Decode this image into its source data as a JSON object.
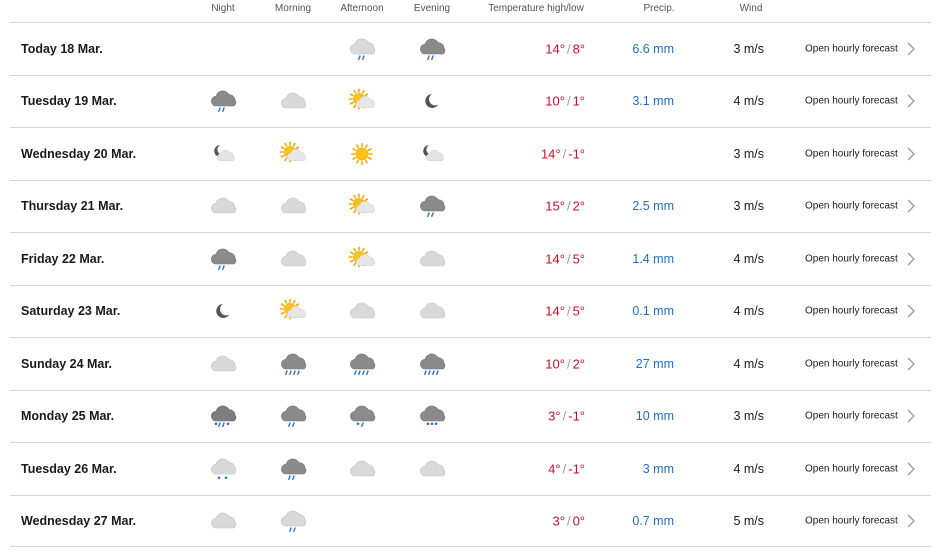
{
  "headers": {
    "night": "Night",
    "morning": "Morning",
    "afternoon": "Afternoon",
    "evening": "Evening",
    "temperature": "Temperature high/low",
    "precip": "Precip.",
    "wind": "Wind"
  },
  "colors": {
    "high_temp": "#c8102e",
    "low_temp": "#c8102e",
    "precip": "#1f6fc8",
    "divider": "#d6d6d6"
  },
  "rows": [
    {
      "day": "Today 18 Mar.",
      "icons": {
        "night": "",
        "morning": "",
        "afternoon": "cloud-light-rain",
        "evening": "cloud-rain"
      },
      "high": "14°",
      "low": "8°",
      "precip": "6.6 mm",
      "wind": "3 m/s",
      "link": "Open hourly forecast"
    },
    {
      "day": "Tuesday 19 Mar.",
      "icons": {
        "night": "cloud-rain",
        "morning": "cloud",
        "afternoon": "partly-sunny",
        "evening": "moon"
      },
      "high": "10°",
      "low": "1°",
      "precip": "3.1 mm",
      "wind": "4 m/s",
      "link": "Open hourly forecast"
    },
    {
      "day": "Wednesday 20 Mar.",
      "icons": {
        "night": "moon-cloud",
        "morning": "partly-sunny",
        "afternoon": "sun",
        "evening": "moon-cloud"
      },
      "high": "14°",
      "low": "-1°",
      "precip": "",
      "wind": "3 m/s",
      "link": "Open hourly forecast"
    },
    {
      "day": "Thursday 21 Mar.",
      "icons": {
        "night": "cloud",
        "morning": "cloud",
        "afternoon": "partly-sunny",
        "evening": "cloud-rain"
      },
      "high": "15°",
      "low": "2°",
      "precip": "2.5 mm",
      "wind": "3 m/s",
      "link": "Open hourly forecast"
    },
    {
      "day": "Friday 22 Mar.",
      "icons": {
        "night": "cloud-rain",
        "morning": "cloud",
        "afternoon": "partly-sunny",
        "evening": "cloud"
      },
      "high": "14°",
      "low": "5°",
      "precip": "1.4 mm",
      "wind": "4 m/s",
      "link": "Open hourly forecast"
    },
    {
      "day": "Saturday 23 Mar.",
      "icons": {
        "night": "moon",
        "morning": "partly-sunny",
        "afternoon": "cloud",
        "evening": "cloud"
      },
      "high": "14°",
      "low": "5°",
      "precip": "0.1 mm",
      "wind": "4 m/s",
      "link": "Open hourly forecast"
    },
    {
      "day": "Sunday 24 Mar.",
      "icons": {
        "night": "cloud",
        "morning": "cloud-heavy-rain",
        "afternoon": "cloud-heavy-rain",
        "evening": "cloud-heavy-rain"
      },
      "high": "10°",
      "low": "2°",
      "precip": "27 mm",
      "wind": "4 m/s",
      "link": "Open hourly forecast"
    },
    {
      "day": "Monday 25 Mar.",
      "icons": {
        "night": "cloud-sleet-heavy",
        "morning": "cloud-rain",
        "afternoon": "cloud-sleet",
        "evening": "cloud-snow"
      },
      "high": "3°",
      "low": "-1°",
      "precip": "10 mm",
      "wind": "3 m/s",
      "link": "Open hourly forecast"
    },
    {
      "day": "Tuesday 26 Mar.",
      "icons": {
        "night": "cloud-light-snow",
        "morning": "cloud-rain",
        "afternoon": "cloud",
        "evening": "cloud"
      },
      "high": "4°",
      "low": "-1°",
      "precip": "3 mm",
      "wind": "4 m/s",
      "link": "Open hourly forecast"
    },
    {
      "day": "Wednesday 27 Mar.",
      "icons": {
        "night": "cloud",
        "morning": "cloud-light-rain",
        "afternoon": "",
        "evening": ""
      },
      "high": "3°",
      "low": "0°",
      "precip": "0.7 mm",
      "wind": "5 m/s",
      "link": "Open hourly forecast"
    }
  ]
}
